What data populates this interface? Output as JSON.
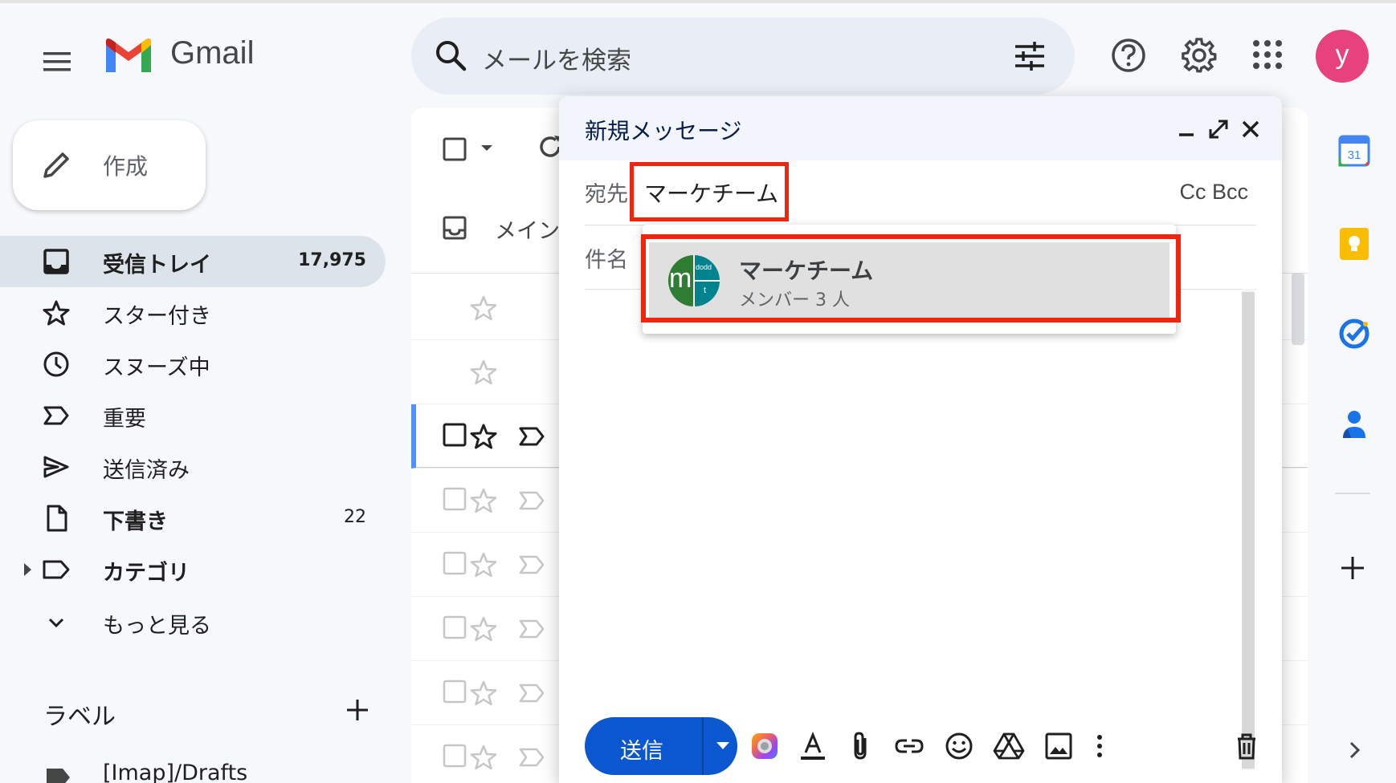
{
  "header": {
    "app_name": "Gmail",
    "search_placeholder": "メールを検索",
    "avatar_letter": "y"
  },
  "sidebar": {
    "compose_label": "作成",
    "items": [
      {
        "label": "受信トレイ",
        "count": "17,975",
        "icon": "inbox-icon",
        "active": true,
        "bold": true
      },
      {
        "label": "スター付き",
        "count": "",
        "icon": "star-icon"
      },
      {
        "label": "スヌーズ中",
        "count": "",
        "icon": "clock-icon"
      },
      {
        "label": "重要",
        "count": "",
        "icon": "important-icon"
      },
      {
        "label": "送信済み",
        "count": "",
        "icon": "send-icon"
      },
      {
        "label": "下書き",
        "count": "22",
        "icon": "file-icon",
        "bold": true
      },
      {
        "label": "カテゴリ",
        "count": "",
        "icon": "label-icon",
        "bold": true
      },
      {
        "label": "もっと見る",
        "count": "",
        "icon": "chevron-down-icon"
      }
    ],
    "labels_heading": "ラベル",
    "label_items": [
      {
        "label": "[Imap]/Drafts"
      }
    ]
  },
  "mail_list": {
    "tab_primary": "メイン"
  },
  "compose_window": {
    "title": "新規メッセージ",
    "to_label": "宛先",
    "to_value": "マーケチーム",
    "cc_bcc": "Cc Bcc",
    "subject_label": "件名",
    "suggestion": {
      "name": "マーケチーム",
      "members": "メンバー 3 人",
      "avatar_big": "m",
      "avatar_small_top": "dodd",
      "avatar_small_bottom": "t"
    },
    "send_label": "送信"
  },
  "colors": {
    "accent": "#0b57d0",
    "highlight": "#f0250e",
    "avatar": "#e8427e"
  }
}
